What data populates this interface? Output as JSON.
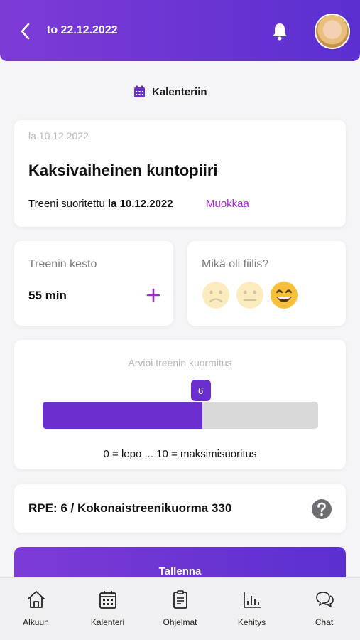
{
  "header": {
    "title": "to 22.12.2022"
  },
  "calendar_link": {
    "label": "Kalenteriin"
  },
  "workout": {
    "date": "la 10.12.2022",
    "title": "Kaksivaiheinen kuntopiiri",
    "done_prefix": "Treeni suoritettu",
    "done_date": "la 10.12.2022",
    "edit_label": "Muokkaa"
  },
  "duration": {
    "label": "Treenin kesto",
    "value": "55 min"
  },
  "feeling": {
    "label": "Mikä oli fiilis?",
    "options": [
      "sad-emoji",
      "neutral-emoji",
      "happy-emoji"
    ],
    "selected": "happy-emoji"
  },
  "load": {
    "label": "Arvioi treenin kuormitus",
    "value": "6",
    "level": 6,
    "max": 10,
    "scale_text": "0 = lepo ... 10 = maksimisuoritus"
  },
  "rpe": {
    "text": "RPE: 6 / Kokonaistreenikuorma 330"
  },
  "save_label": "Tallenna",
  "tabs": [
    {
      "label": "Alkuun",
      "icon": "home-icon"
    },
    {
      "label": "Kalenteri",
      "icon": "calendar-icon"
    },
    {
      "label": "Ohjelmat",
      "icon": "clipboard-icon"
    },
    {
      "label": "Kehitys",
      "icon": "bar-chart-icon"
    },
    {
      "label": "Chat",
      "icon": "chat-icon"
    }
  ],
  "colors": {
    "accent": "#6b2fd0",
    "link": "#a626d6",
    "track": "#d9d9d9"
  }
}
